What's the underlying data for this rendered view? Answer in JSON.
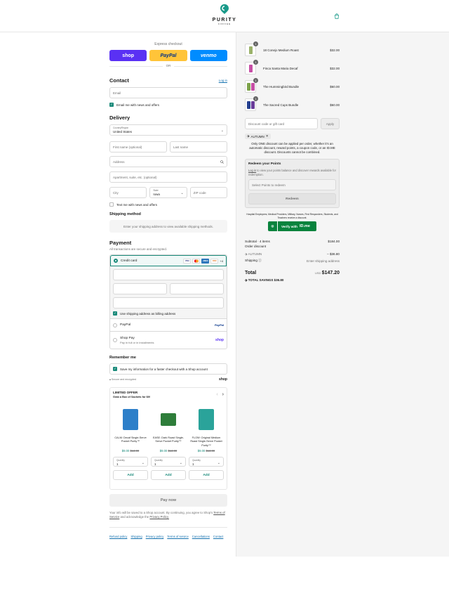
{
  "header": {
    "brand": "PURITY",
    "brand_sub": "COFFEE"
  },
  "express": {
    "label": "Express checkout",
    "shop": "shop",
    "paypal": "PayPal",
    "venmo": "venmo",
    "or": "OR"
  },
  "contact": {
    "title": "Contact",
    "login": "Log in",
    "email_placeholder": "Email",
    "news_label": "Email me with news and offers"
  },
  "delivery": {
    "title": "Delivery",
    "country_label": "Country/Region",
    "country_value": "United States",
    "first_name": "First name (optional)",
    "last_name": "Last name",
    "address": "Address",
    "apartment": "Apartment, suite, etc. (optional)",
    "city": "City",
    "state_label": "State",
    "state_value": "Iowa",
    "zip": "ZIP code",
    "text_label": "Text me with news and offers"
  },
  "shipping": {
    "title": "Shipping method",
    "message": "Enter your shipping address to view available shipping methods."
  },
  "payment": {
    "title": "Payment",
    "subtitle": "All transactions are secure and encrypted.",
    "credit_card": "Credit card",
    "card_badges": [
      "VISA",
      "MC",
      "AMEX",
      "DISC"
    ],
    "more_cards": "+4",
    "billing_label": "Use shipping address as billing address",
    "paypal": "PayPal",
    "paypal_logo": "PayPal",
    "shop_pay": "Shop Pay",
    "shop_pay_sub": "Pay in full or in installments",
    "shop_logo": "shop"
  },
  "remember": {
    "title": "Remember me",
    "save_label": "Save my information for a faster checkout with a Shop account",
    "secure": "Secure and encrypted",
    "shop_logo": "shop"
  },
  "offer": {
    "title": "LIMITED OFFER",
    "subtitle": "Grab a Box of Sachets for $9!",
    "products": [
      {
        "name": "CALM: Decaf Single-Serve Pocket Purity™",
        "sale": "$9.00",
        "old": "$13.00",
        "qty_label": "Quantity",
        "qty": "1",
        "add": "Add",
        "color": "#2d7fc9"
      },
      {
        "name": "EASE: Dark Roast Single-Serve Pocket Purity™",
        "sale": "$9.00",
        "old": "$13.00",
        "qty_label": "Quantity",
        "qty": "1",
        "add": "Add",
        "color": "#2e7d3a"
      },
      {
        "name": "FLOW: Original Medium Roast Single-Serve Pocket Purity™",
        "sale": "$9.00",
        "old": "$13.00",
        "qty_label": "Quantity",
        "qty": "1",
        "add": "Add",
        "color": "#2aa39a"
      }
    ]
  },
  "paynow": "Pay now",
  "legal": {
    "text": "Your info will be saved to a Shop account. By continuing, you agree to Shop's",
    "terms": "Terms of Service",
    "and": "and acknowledge the",
    "privacy": "Privacy Policy."
  },
  "footer": [
    "Refund policy",
    "Shipping",
    "Privacy policy",
    "Terms of service",
    "Cancellations",
    "Contact"
  ],
  "cart": {
    "items": [
      {
        "qty": "1",
        "name": "18 Conejo Medium Roast",
        "price": "$32.00",
        "colors": [
          "#9bb26a"
        ]
      },
      {
        "qty": "1",
        "name": "Finca Santa Maria Decaf",
        "price": "$32.00",
        "colors": [
          "#c74fa6"
        ]
      },
      {
        "qty": "1",
        "name": "The Hummingbird Bundle",
        "price": "$60.00",
        "colors": [
          "#7da34a",
          "#c74fa6"
        ]
      },
      {
        "qty": "1",
        "name": "The Sacred Cups Bundle",
        "price": "$60.00",
        "colors": [
          "#24408f",
          "#6a3c9a"
        ]
      }
    ],
    "discount_placeholder": "Discount code or gift card",
    "apply": "Apply",
    "tag": "AUTUMN",
    "note": "Only ONE discount can be applied per order, whether it's an automatic discount, reward points, a coupon code, or an ID.ME discount. Discounts cannot be combined.",
    "points_title": "Redeem your Points",
    "points_login": "Log in",
    "points_text": "to view your points balance and discover rewards available for redemption.",
    "points_select": "Select Points to redeem",
    "redeem": "Redeem",
    "idme_note": "Hospital Employees, Medical Providers, Military, Nurses, First Responders, Students, and Teachers receive a discount.",
    "idme_btn": "Verify with",
    "idme_logo": "ID.me",
    "subtotal_label": "Subtotal · 4 items",
    "subtotal": "$184.00",
    "order_discount": "Order discount",
    "discount_code": "AUTUMN",
    "discount_value": "– $36.80",
    "shipping_label": "Shipping",
    "shipping_value": "Enter shipping address",
    "total_label": "Total",
    "currency": "USD",
    "total": "$147.20",
    "savings_label": "TOTAL SAVINGS",
    "savings": "$36.80"
  }
}
